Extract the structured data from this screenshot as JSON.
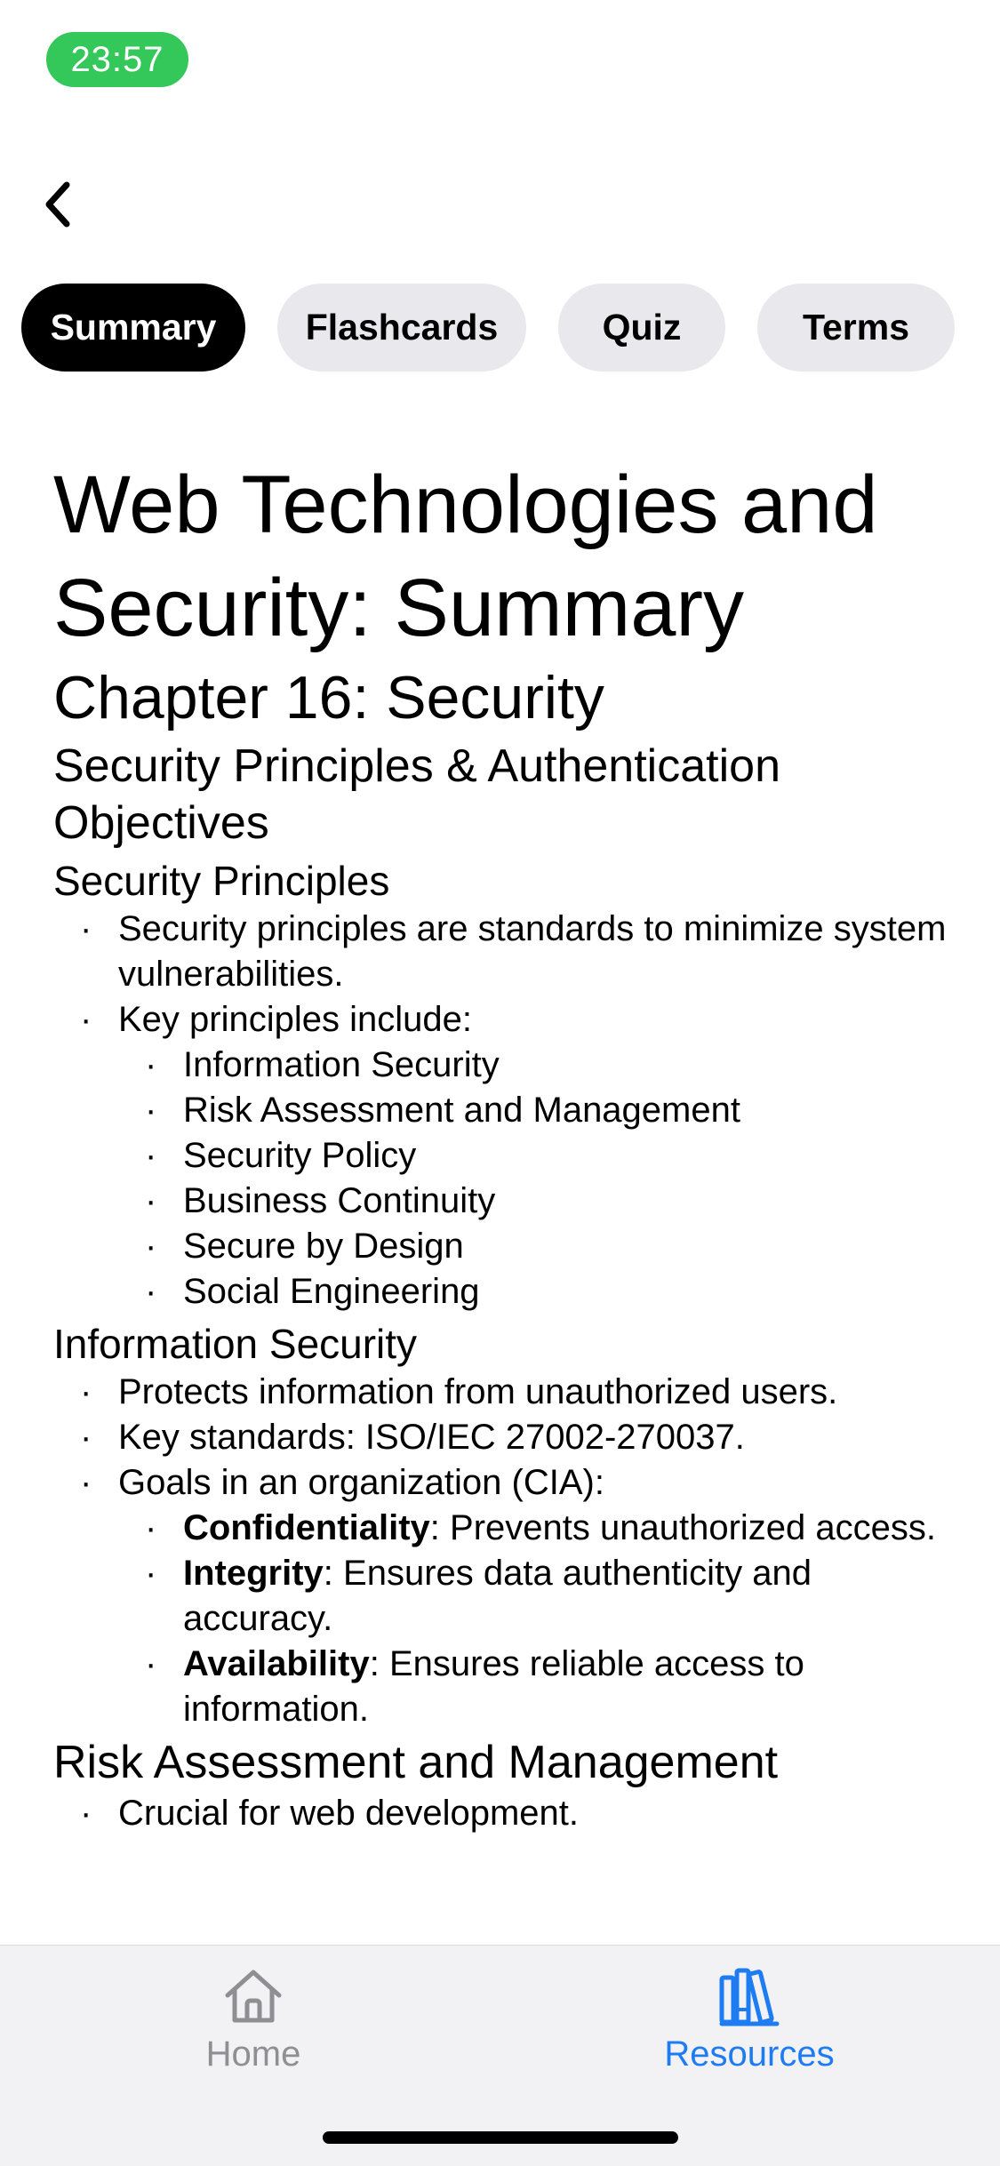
{
  "status_bar": {
    "time": "23:57"
  },
  "tabs": [
    {
      "label": "Summary",
      "active": true
    },
    {
      "label": "Flashcards",
      "active": false
    },
    {
      "label": "Quiz",
      "active": false
    },
    {
      "label": "Terms",
      "active": false
    }
  ],
  "document": {
    "title": "Web Technologies and Security: Summary",
    "chapter": "Chapter 16: Security",
    "section": "Security Principles & Authentication Objectives",
    "sub1": {
      "heading": "Security Principles",
      "item1": "Security principles are standards to minimize system vulnerabilities.",
      "item2": "Key principles include:",
      "principles": [
        "Information Security",
        "Risk Assessment and Management",
        "Security Policy",
        "Business Continuity",
        "Secure by Design",
        "Social Engineering"
      ]
    },
    "sub2": {
      "heading": "Information Security",
      "item1": "Protects information from unauthorized users.",
      "item2": "Key standards: ISO/IEC 27002-270037.",
      "item3": "Goals in an organization (CIA):",
      "goals": [
        {
          "term": "Confidentiality",
          "text": ": Prevents unauthorized access."
        },
        {
          "term": "Integrity",
          "text": ": Ensures data authenticity and accuracy."
        },
        {
          "term": "Availability",
          "text": ": Ensures reliable access to information."
        }
      ]
    },
    "sub3": {
      "heading": "Risk Assessment and Management",
      "item1": "Crucial for web development."
    }
  },
  "tab_bar": {
    "home_label": "Home",
    "resources_label": "Resources",
    "active": "Resources",
    "home_icon": "house-icon",
    "resources_icon": "books-icon",
    "active_color": "#1e7cf2",
    "inactive_color": "#8e8e93"
  },
  "colors": {
    "status_time_bg": "#34c759",
    "active_tab_bg": "#000000",
    "inactive_tab_bg": "#e8e8ed"
  }
}
